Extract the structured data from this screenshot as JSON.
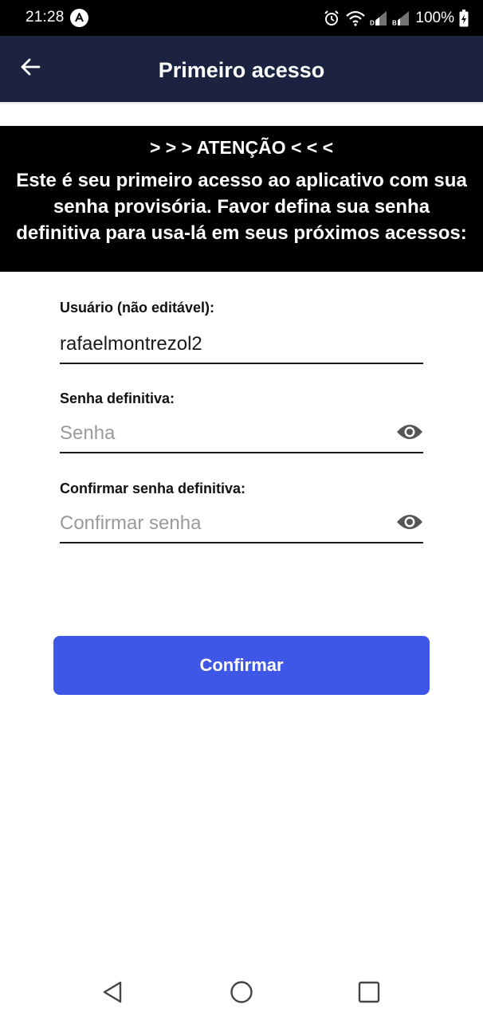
{
  "status_bar": {
    "time": "21:28",
    "battery": "100%",
    "icons": [
      "app-notification-icon",
      "alarm-icon",
      "wifi-icon",
      "signal-icon",
      "signal-icon",
      "battery-charging-icon"
    ]
  },
  "app_bar": {
    "title": "Primeiro acesso",
    "back_icon": "arrow-left-icon",
    "background_color": "#1b2340"
  },
  "banner": {
    "title": "> > > ATENÇÃO < < <",
    "message": "Este é seu primeiro acesso ao aplicativo com sua senha provisória. Favor defina sua senha definitiva para usa-lá em seus próximos acessos:"
  },
  "form": {
    "user": {
      "label": "Usuário (não editável):",
      "value": "rafaelmontrezol2"
    },
    "password": {
      "label": "Senha definitiva:",
      "placeholder": "Senha",
      "icon": "eye-icon"
    },
    "confirm_password": {
      "label": "Confirmar senha definitiva:",
      "placeholder": "Confirmar senha",
      "icon": "eye-icon"
    },
    "confirm_button": {
      "label": "Confirmar",
      "color": "#3f57e6"
    }
  },
  "nav_bar": {
    "icons": [
      "nav-back-icon",
      "nav-home-icon",
      "nav-recents-icon"
    ]
  }
}
